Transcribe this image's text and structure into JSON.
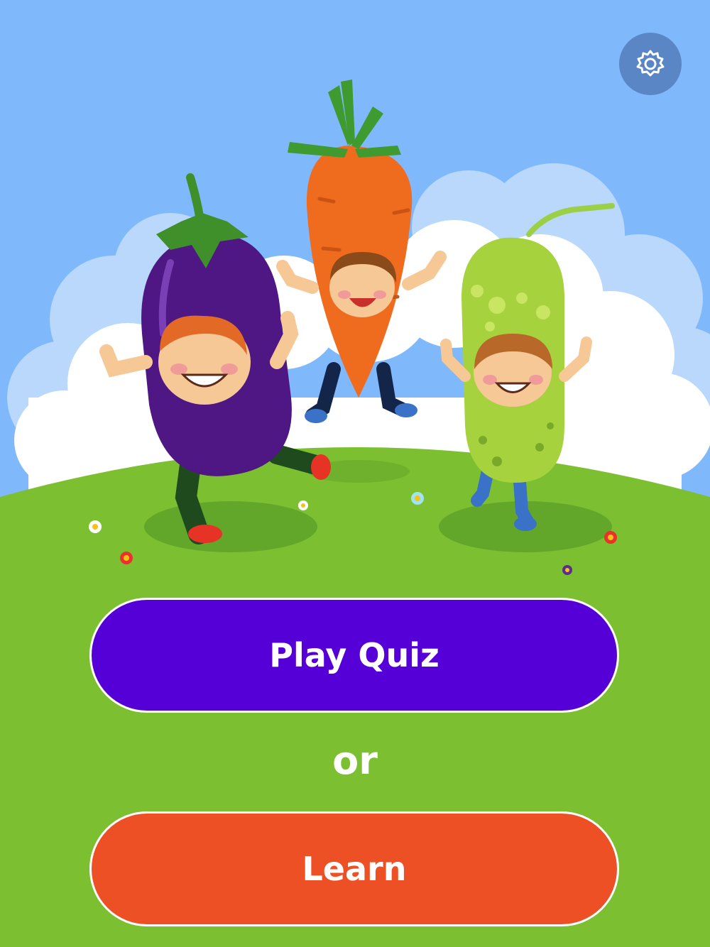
{
  "header": {
    "settings_icon": "gear-icon"
  },
  "menu": {
    "play_label": "Play Quiz",
    "or_label": "or",
    "learn_label": "Learn"
  },
  "colors": {
    "sky": "#7fb8fb",
    "grass": "#7cc031",
    "play_button": "#5500d6",
    "learn_button": "#ee5026",
    "settings_button": "#5a86c6"
  },
  "illustration": {
    "characters": [
      "eggplant-kid",
      "carrot-kid",
      "cucumber-kid"
    ]
  }
}
